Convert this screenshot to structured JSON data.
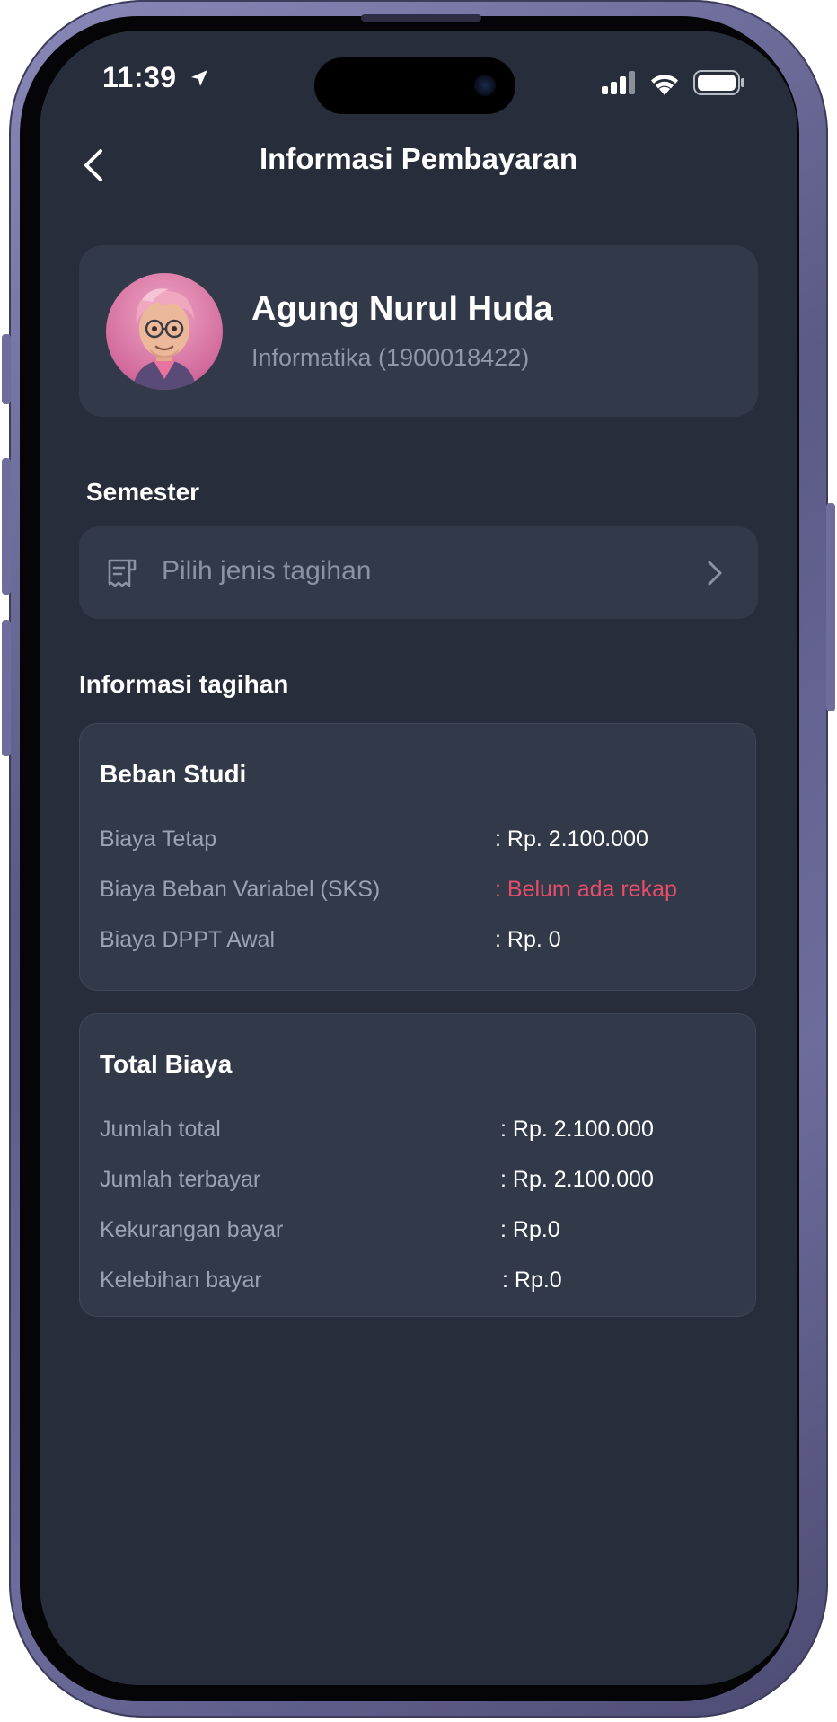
{
  "status_bar": {
    "time": "11:39"
  },
  "header": {
    "title": "Informasi Pembayaran"
  },
  "profile": {
    "name": "Agung Nurul Huda",
    "subtitle": "Informatika (1900018422)"
  },
  "semester": {
    "label": "Semester",
    "placeholder": "Pilih jenis tagihan"
  },
  "billing": {
    "section_title": "Informasi tagihan",
    "beban_studi": {
      "title": "Beban Studi",
      "rows": [
        {
          "label": "Biaya Tetap",
          "value": ": Rp. 2.100.000"
        },
        {
          "label": "Biaya Beban Variabel (SKS)",
          "value": ": Belum ada rekap"
        },
        {
          "label": "Biaya DPPT Awal",
          "value": ": Rp. 0"
        }
      ]
    },
    "total_biaya": {
      "title": "Total Biaya",
      "rows": [
        {
          "label": "Jumlah total",
          "value": ": Rp. 2.100.000"
        },
        {
          "label": "Jumlah terbayar",
          "value": ": Rp. 2.100.000"
        },
        {
          "label": "Kekurangan bayar",
          "value": ": Rp.0"
        },
        {
          "label": "Kelebihan bayar",
          "value": ": Rp.0"
        }
      ]
    }
  },
  "colors": {
    "background": "#272d3b",
    "card": "#323a4a",
    "alert": "#e64d68",
    "muted_text": "#9aa3b2"
  },
  "icons": [
    "back-chevron-icon",
    "receipt-icon",
    "chevron-right-icon",
    "location-arrow-icon",
    "signal-icon",
    "wifi-icon",
    "battery-icon"
  ]
}
